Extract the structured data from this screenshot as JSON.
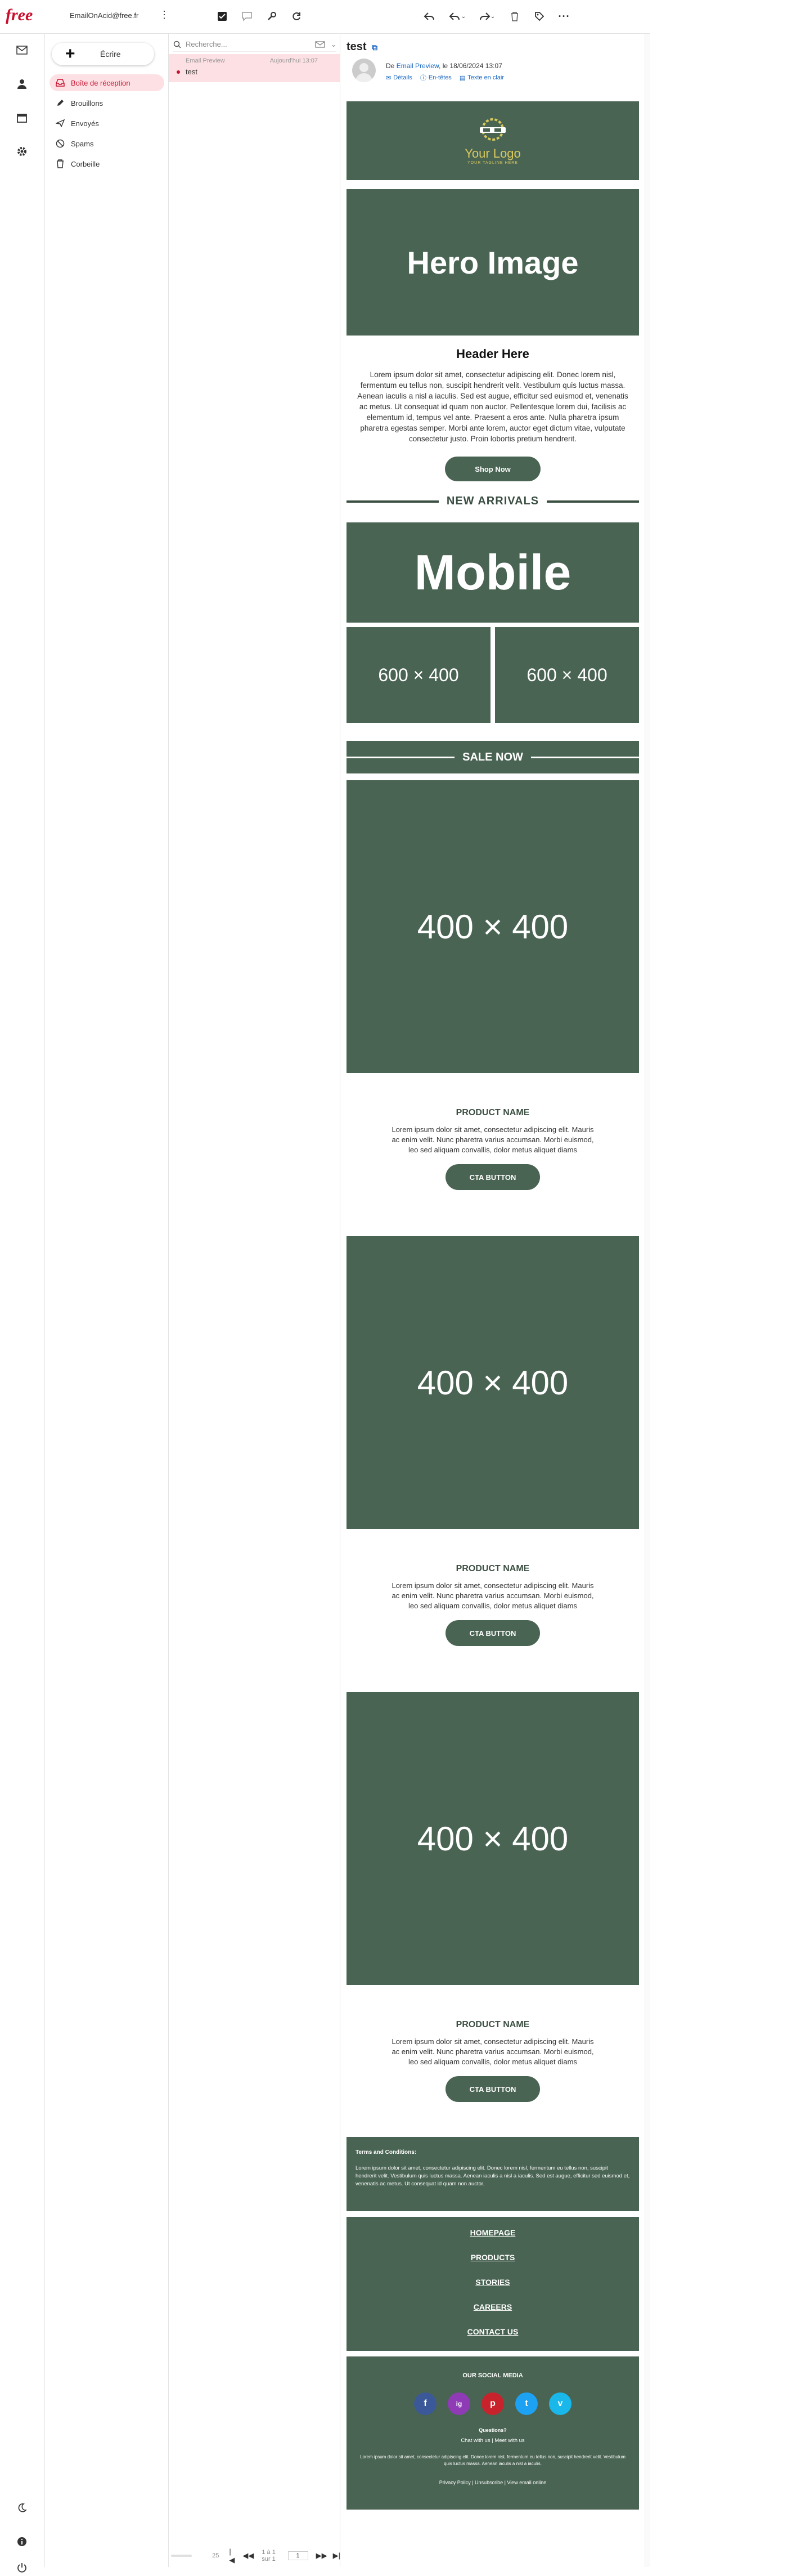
{
  "header": {
    "logo": "free",
    "account": "EmailOnAcid@free.fr"
  },
  "sidebar": {
    "compose_label": "Écrire",
    "folders": [
      {
        "label": "Boîte de réception"
      },
      {
        "label": "Brouillons"
      },
      {
        "label": "Envoyés"
      },
      {
        "label": "Spams"
      },
      {
        "label": "Corbeille"
      }
    ]
  },
  "list": {
    "search_placeholder": "Recherche...",
    "items": [
      {
        "from": "Email Preview",
        "date": "Aujourd'hui 13:07",
        "subject": "test"
      }
    ],
    "pager": {
      "range": "1 à 1 sur 1",
      "page": "1",
      "size": "25"
    }
  },
  "message": {
    "subject": "test",
    "from_prefix": "De",
    "from_name": "Email Preview",
    "date_text": ", le 18/06/2024 13:07",
    "links": {
      "details": "Détails",
      "headers": "En-têtes",
      "plain": "Texte en clair"
    }
  },
  "email": {
    "logo_text": "Your Logo",
    "logo_tagline": "YOUR TAGLINE HERE",
    "hero": "Hero Image",
    "header": "Header Here",
    "body": "Lorem ipsum dolor sit amet, consectetur adipiscing elit. Donec lorem nisl, fermentum eu tellus non, suscipit hendrerit velit. Vestibulum quis luctus massa. Aenean iaculis a nisl a iaculis. Sed est augue, efficitur sed euismod et, venenatis ac metus. Ut consequat id quam non auctor. Pellentesque lorem dui, facilisis ac elementum id, tempus vel ante. Praesent a eros ante. Nulla pharetra ipsum pharetra egestas semper. Morbi ante lorem, auctor eget dictum vitae, vulputate consectetur justo. Proin lobortis pretium hendrerit.",
    "shop_now": "Shop Now",
    "new_arrivals": "NEW ARRIVALS",
    "mobile": "Mobile",
    "tile_a": "600 × 400",
    "tile_b": "600 × 400",
    "sale_now": "SALE NOW",
    "products": [
      {
        "image": "400 × 400",
        "name": "PRODUCT NAME",
        "desc": "Lorem ipsum dolor sit amet, consectetur adipiscing elit. Mauris ac enim velit. Nunc pharetra varius accumsan. Morbi euismod, leo sed aliquam convallis, dolor metus aliquet diams",
        "cta": "CTA BUTTON"
      },
      {
        "image": "400 × 400",
        "name": "PRODUCT NAME",
        "desc": "Lorem ipsum dolor sit amet, consectetur adipiscing elit. Mauris ac enim velit. Nunc pharetra varius accumsan. Morbi euismod, leo sed aliquam convallis, dolor metus aliquet diams",
        "cta": "CTA BUTTON"
      },
      {
        "image": "400 × 400",
        "name": "PRODUCT NAME",
        "desc": "Lorem ipsum dolor sit amet, consectetur adipiscing elit. Mauris ac enim velit. Nunc pharetra varius accumsan. Morbi euismod, leo sed aliquam convallis, dolor metus aliquet diams",
        "cta": "CTA BUTTON"
      }
    ],
    "terms_title": "Terms and Conditions:",
    "terms_body": "Lorem ipsum dolor sit amet, consectetur adipiscing elit. Donec lorem nisl, fermentum eu tellus non, suscipit hendrerit velit. Vestibulum quis luctus massa. Aenean iaculis a nisl a iaculis. Sed est augue, efficitur sed euismod et, venenatis ac metus. Ut consequat id quam non auctor.",
    "nav": [
      "HOMEPAGE",
      "PRODUCTS",
      "STORIES",
      "CAREERS",
      "CONTACT US"
    ],
    "social_title": "OUR SOCIAL MEDIA",
    "social": [
      "f",
      "ig",
      "p",
      "t",
      "v"
    ],
    "questions": "Questions?",
    "chat": "Chat with us | Meet with us",
    "footer_body": "Lorem ipsum dolor sit amet, consectetur adipiscing elit. Donec lorem nisl, fermentum eu tellus non, suscipit hendrerit velit. Vestibulum quis luctus massa. Aenean iaculis a nisl a iaculis.",
    "footer_links": "Privacy Policy | Unsubscribe | View email online"
  },
  "colors": {
    "brand": "#c8102e",
    "email_green": "#4a6453",
    "link": "#1565c0",
    "active_folder_bg": "#fde0e3"
  }
}
